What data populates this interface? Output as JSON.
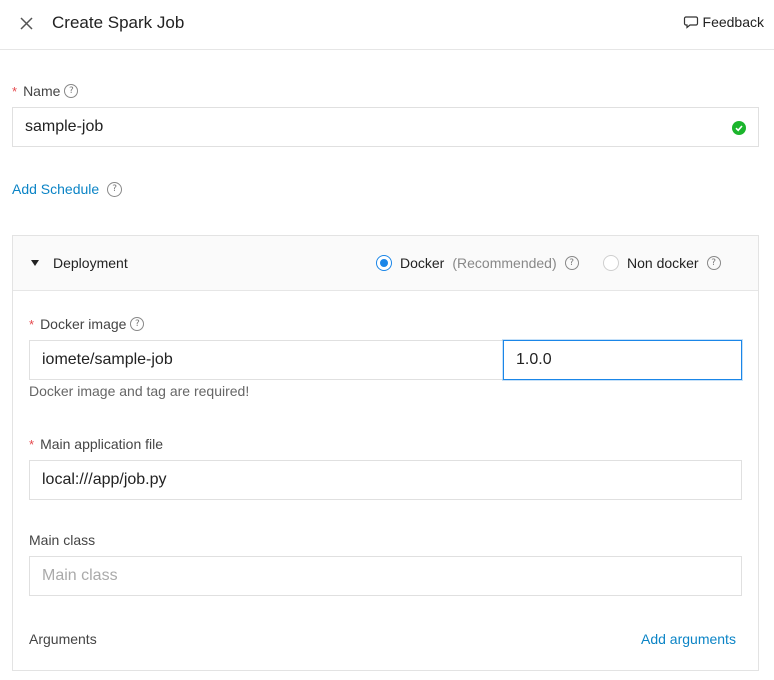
{
  "header": {
    "title": "Create Spark Job",
    "feedback_label": "Feedback"
  },
  "name_field": {
    "label": "Name",
    "value": "sample-job"
  },
  "add_schedule_label": "Add Schedule",
  "deployment": {
    "title": "Deployment",
    "options": [
      {
        "label": "Docker",
        "note": "(Recommended)",
        "selected": true
      },
      {
        "label": "Non docker",
        "selected": false
      }
    ],
    "docker_image": {
      "label": "Docker image",
      "image_value": "iomete/sample-job",
      "tag_value": "1.0.0",
      "hint": "Docker image and tag are required!"
    },
    "main_app_file": {
      "label": "Main application file",
      "value": "local:///app/job.py"
    },
    "main_class": {
      "label": "Main class",
      "placeholder": "Main class"
    },
    "arguments": {
      "label": "Arguments",
      "add_label": "Add arguments"
    }
  },
  "colors": {
    "accent": "#1a86e8",
    "link": "#0b84c6",
    "required": "#e5484d",
    "success": "#1bb52c"
  }
}
